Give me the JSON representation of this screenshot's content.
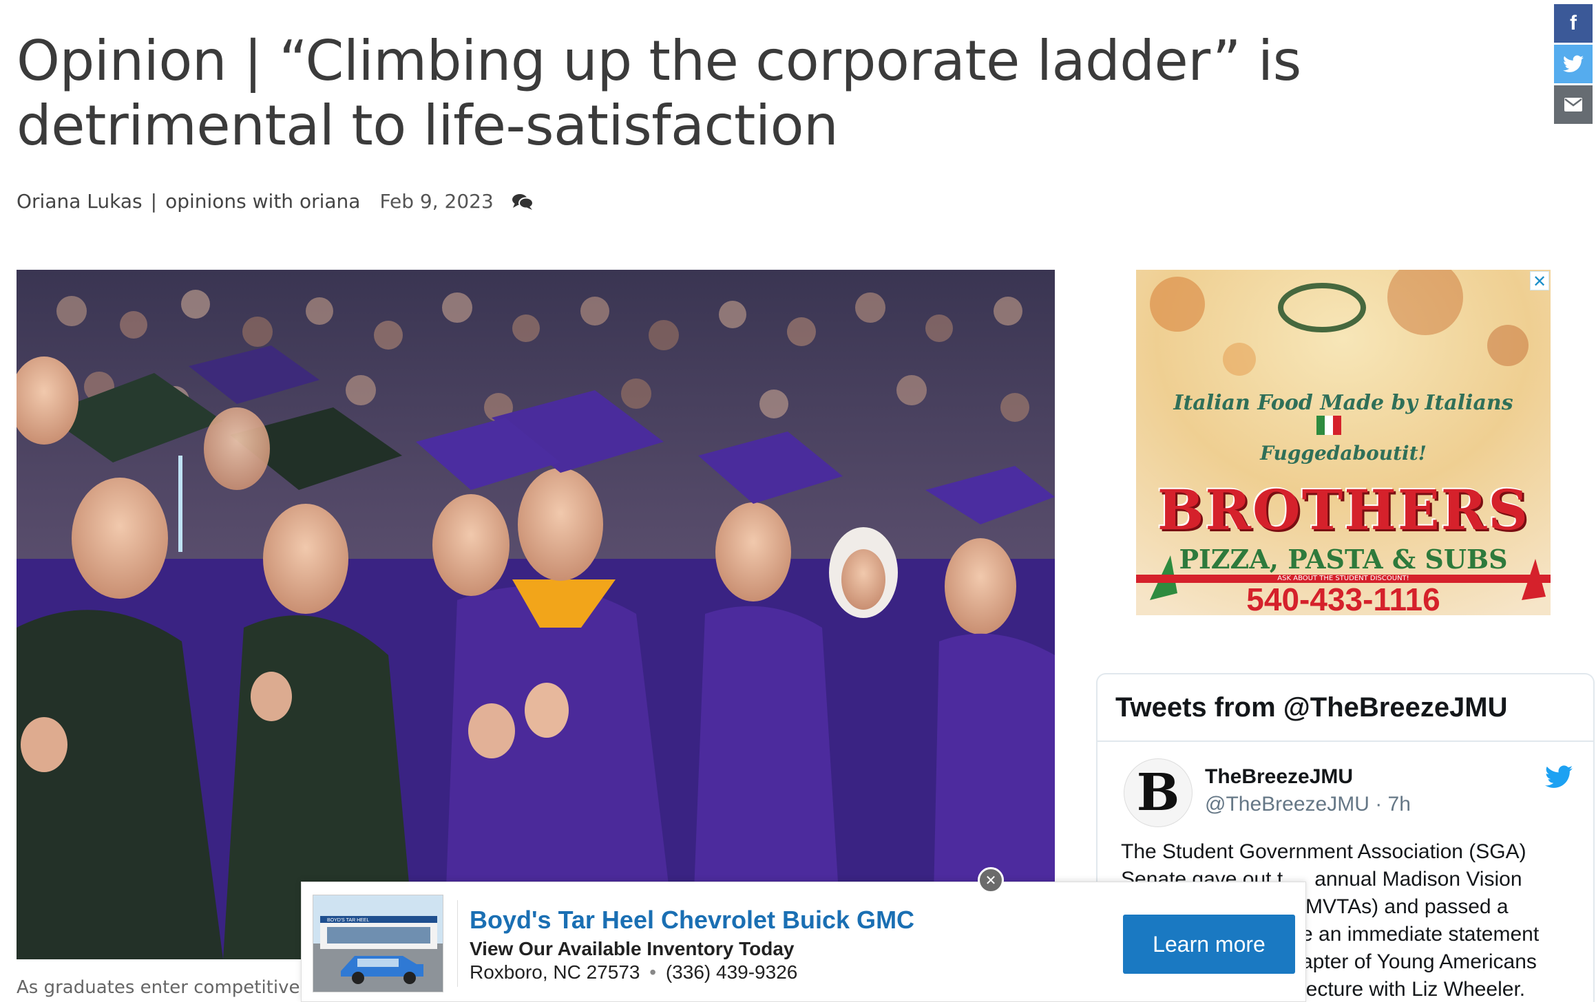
{
  "article": {
    "headline": "Opinion | “Climbing up the corporate ladder” is detrimental to life-satisfaction",
    "author": "Oriana Lukas",
    "separator": "|",
    "column": "opinions with oriana",
    "date": "Feb 9, 2023",
    "comment_icon": "comments-icon",
    "caption": "As graduates enter competitive wo"
  },
  "share": {
    "facebook": {
      "icon": "facebook-icon",
      "glyph": "f",
      "color": "#3b5998"
    },
    "twitter": {
      "icon": "twitter-icon",
      "color": "#55acee"
    },
    "email": {
      "icon": "email-icon",
      "color": "#666c72"
    }
  },
  "ad_pizza": {
    "close": "✕",
    "tagline1": "Italian Food Made by Italians",
    "tagline2": "Fuggedaboutit!",
    "brand": "BROTHERS",
    "sub": "PIZZA, PASTA & SUBS",
    "strip": "ASK ABOUT THE STUDENT DISCOUNT!",
    "phone": "540-433-1116"
  },
  "tweets": {
    "title": "Tweets from @TheBreezeJMU",
    "avatar_letter": "B",
    "name": "TheBreezeJMU",
    "handle": "@TheBreezeJMU · 7h",
    "text": "The Student Government Association (SGA) Senate gave out the annual Madison Vision ... (MVTAs) and passed a ... an immediate statement ... chapter of Young Americans ... lecture with Liz Wheeler.",
    "lines": [
      "The Student Government Association (SGA)",
      "Senate gave out t",
      "annual Madison Vision",
      "MVTAs) and passed a",
      "e an immediate statement",
      "apter of Young Americans",
      "lecture with Liz Wheeler."
    ]
  },
  "ad_car": {
    "title": "Boyd's Tar Heel Chevrolet Buick GMC",
    "subtitle": "View Our Available Inventory Today",
    "address": "Roxboro, NC 27573",
    "dot": "•",
    "phone": "(336) 439-9326",
    "cta": "Learn more",
    "close": "✕",
    "dealer_sign": "BOYD'S TAR HEEL"
  },
  "colors": {
    "headline": "#3b3b3b",
    "cta_blue": "#1a79c2",
    "link_blue": "#1a6fb3",
    "gown_purple": "#4b2a9a"
  }
}
